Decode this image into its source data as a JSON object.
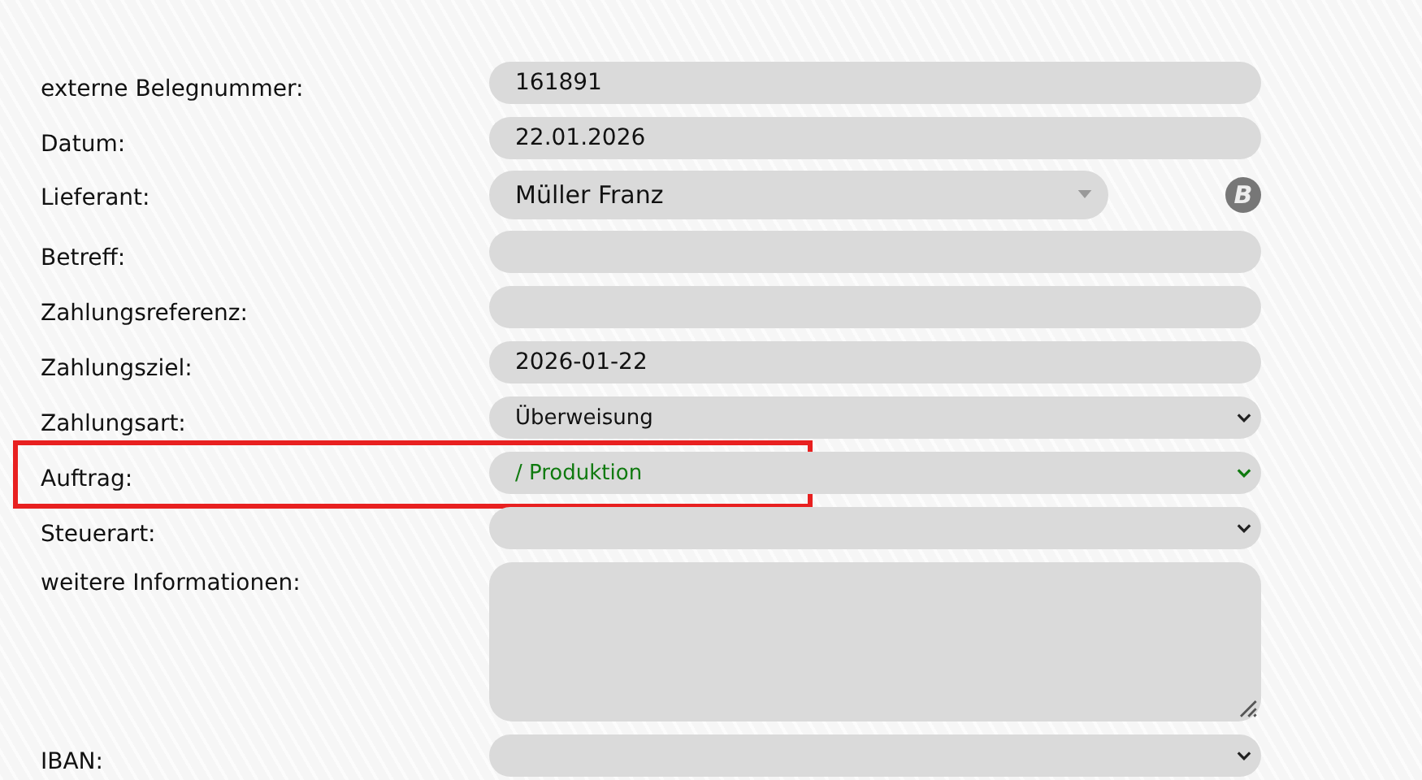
{
  "form": {
    "rows": [
      {
        "label": "externe Belegnummer:",
        "kind": "text",
        "value": "161891"
      },
      {
        "label": "Datum:",
        "kind": "text",
        "value": "22.01.2026"
      },
      {
        "label": "Lieferant:",
        "kind": "combobox",
        "value": "Müller Franz",
        "side_icon": "B"
      },
      {
        "label": "Betreff:",
        "kind": "text"
      },
      {
        "label": "Zahlungsreferenz:",
        "kind": "text"
      },
      {
        "label": "Zahlungsziel:",
        "kind": "text",
        "value": "2026-01-22"
      },
      {
        "label": "Zahlungsart:",
        "kind": "select",
        "value": "Überweisung"
      },
      {
        "label": "Auftrag:",
        "kind": "select",
        "value": "/ Produktion",
        "color": "#0f7a0f",
        "highlighted": true
      },
      {
        "label": "Steuerart:",
        "kind": "select"
      },
      {
        "label": "weitere Informationen:",
        "kind": "textarea"
      },
      {
        "label": "IBAN:",
        "kind": "select"
      }
    ]
  }
}
